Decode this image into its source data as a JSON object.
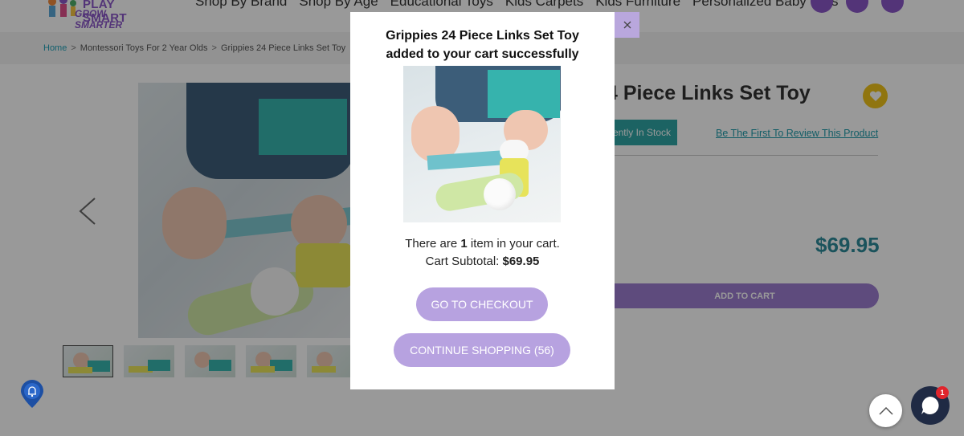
{
  "header": {
    "logo_line1": "PLAY SMART",
    "logo_line2": "GROW SMARTER",
    "nav": [
      "Shop By Brand",
      "Shop By Age",
      "Educational Toys",
      "Kids Carpets",
      "Kids Furniture",
      "Personalized Baby Gifts"
    ]
  },
  "breadcrumb": {
    "home": "Home",
    "items": [
      "Montessori Toys For 2 Year Olds",
      "Grippies 24 Piece Links Set Toy"
    ],
    "separator": ">"
  },
  "product": {
    "title_partial": "4 Piece Links Set Toy",
    "stock_text": "ently In Stock",
    "review_link": "Be The First To Review This Product",
    "price": "$69.95",
    "add_to_cart": "ADD TO CART"
  },
  "modal": {
    "title_line1": "Grippies 24 Piece Links Set Toy",
    "title_line2": "added to your cart successfully",
    "item_text_pre": "There are ",
    "item_count": "1",
    "item_text_post": " item in your cart.",
    "subtotal_label": "Cart Subtotal: ",
    "subtotal_value": "$69.95",
    "checkout_button": "GO TO CHECKOUT",
    "continue_button": "CONTINUE SHOPPING (56)"
  },
  "chat": {
    "unread_count": "1"
  },
  "colors": {
    "accent_purple": "#b7a2e0",
    "teal": "#2fa6a6",
    "price_teal": "#2d8a99"
  },
  "icons": [
    "close-icon",
    "chevron-left-icon",
    "chevron-up-icon",
    "chat-icon",
    "heart-icon",
    "bell-icon",
    "search-icon",
    "user-icon",
    "cart-icon"
  ]
}
